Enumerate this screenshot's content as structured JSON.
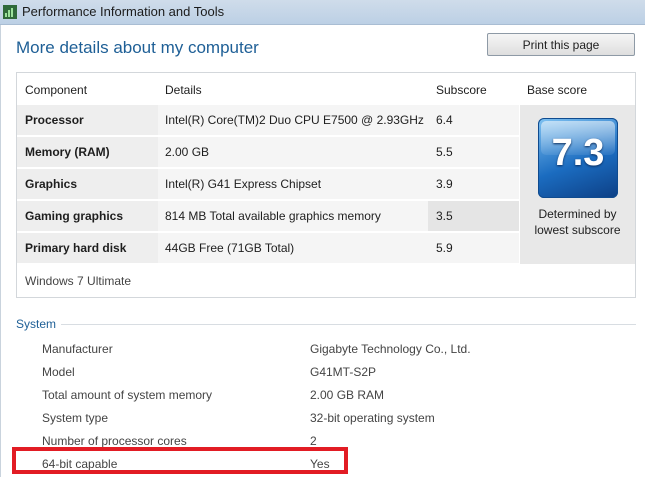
{
  "window": {
    "title": "Performance Information and Tools",
    "icon": "performance-app-icon"
  },
  "page": {
    "heading": "More details about my computer",
    "print_label": "Print this page"
  },
  "scores_table": {
    "headers": {
      "component": "Component",
      "details": "Details",
      "subscore": "Subscore",
      "base": "Base score"
    },
    "rows": [
      {
        "component": "Processor",
        "details": "Intel(R) Core(TM)2 Duo CPU E7500 @ 2.93GHz",
        "subscore": "6.4"
      },
      {
        "component": "Memory (RAM)",
        "details": "2.00 GB",
        "subscore": "5.5"
      },
      {
        "component": "Graphics",
        "details": "Intel(R) G41 Express Chipset",
        "subscore": "3.9"
      },
      {
        "component": "Gaming graphics",
        "details": "814 MB Total available graphics memory",
        "subscore": "3.5"
      },
      {
        "component": "Primary hard disk",
        "details": "44GB Free (71GB Total)",
        "subscore": "5.9"
      }
    ],
    "base_score": "7.3",
    "base_caption_line1": "Determined by",
    "base_caption_line2": "lowest subscore",
    "os_name": "Windows 7 Ultimate"
  },
  "system": {
    "heading": "System",
    "rows": [
      {
        "label": "Manufacturer",
        "value": "Gigabyte Technology Co., Ltd."
      },
      {
        "label": "Model",
        "value": "G41MT-S2P"
      },
      {
        "label": "Total amount of system memory",
        "value": "2.00 GB RAM"
      },
      {
        "label": "System type",
        "value": "32-bit operating system"
      },
      {
        "label": "Number of processor cores",
        "value": "2"
      },
      {
        "label": "64-bit capable",
        "value": "Yes"
      }
    ]
  },
  "colors": {
    "accent": "#1e5f96",
    "highlight_box": "#e21c24"
  }
}
